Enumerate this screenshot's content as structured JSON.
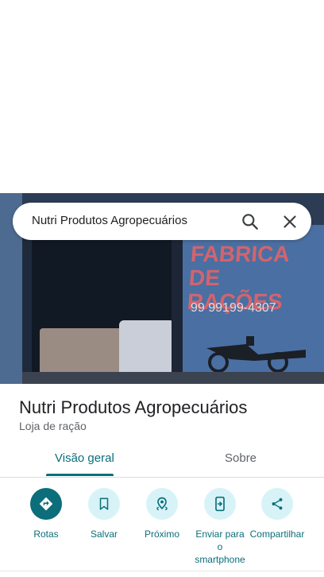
{
  "search": {
    "query": "Nutri Produtos Agropecuários",
    "search_icon": "search-icon",
    "close_icon": "close-icon"
  },
  "photo": {
    "sign_text": "FABRICA DE RAÇÕES",
    "phone_text": "99 99199-4307"
  },
  "place": {
    "name": "Nutri Produtos Agropecuários",
    "category": "Loja de ração"
  },
  "tabs": [
    {
      "label": "Visão geral",
      "selected": true
    },
    {
      "label": "Sobre",
      "selected": false
    }
  ],
  "actions": [
    {
      "label": "Rotas",
      "icon": "directions-icon"
    },
    {
      "label": "Salvar",
      "icon": "bookmark-icon"
    },
    {
      "label": "Próximo",
      "icon": "nearby-icon"
    },
    {
      "label": "Enviar para o smartphone",
      "icon": "send-to-phone-icon"
    },
    {
      "label": "Compartilhar",
      "icon": "share-icon"
    }
  ],
  "colors": {
    "accent": "#0b6e7a",
    "action_bg": "#d7f3f8"
  }
}
